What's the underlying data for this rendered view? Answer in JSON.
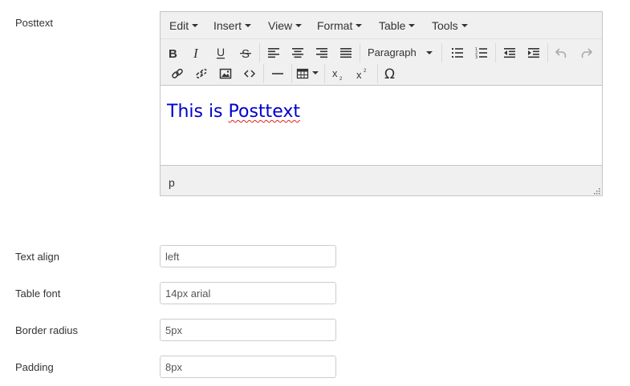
{
  "posttext_label": "Posttext",
  "editor": {
    "menus": [
      {
        "label": "Edit"
      },
      {
        "label": "Insert"
      },
      {
        "label": "View"
      },
      {
        "label": "Format"
      },
      {
        "label": "Table"
      },
      {
        "label": "Tools"
      }
    ],
    "format_select": "Paragraph",
    "content": {
      "prefix": "This is ",
      "word": "Posttext",
      "color": "#0000cc"
    },
    "status_path": "p",
    "toolbar_icons": [
      "bold-icon",
      "italic-icon",
      "underline-icon",
      "strikethrough-icon",
      "align-left-icon",
      "align-center-icon",
      "align-right-icon",
      "align-justify-icon",
      "bullet-list-icon",
      "numbered-list-icon",
      "outdent-icon",
      "indent-icon",
      "undo-icon",
      "redo-icon",
      "link-icon",
      "unlink-icon",
      "image-icon",
      "code-icon",
      "horizontal-rule-icon",
      "table-icon",
      "subscript-icon",
      "superscript-icon",
      "special-character-icon"
    ]
  },
  "fields": [
    {
      "label": "Text align",
      "value": "left"
    },
    {
      "label": "Table font",
      "value": "14px arial"
    },
    {
      "label": "Border radius",
      "value": "5px"
    },
    {
      "label": "Padding",
      "value": "8px"
    }
  ]
}
